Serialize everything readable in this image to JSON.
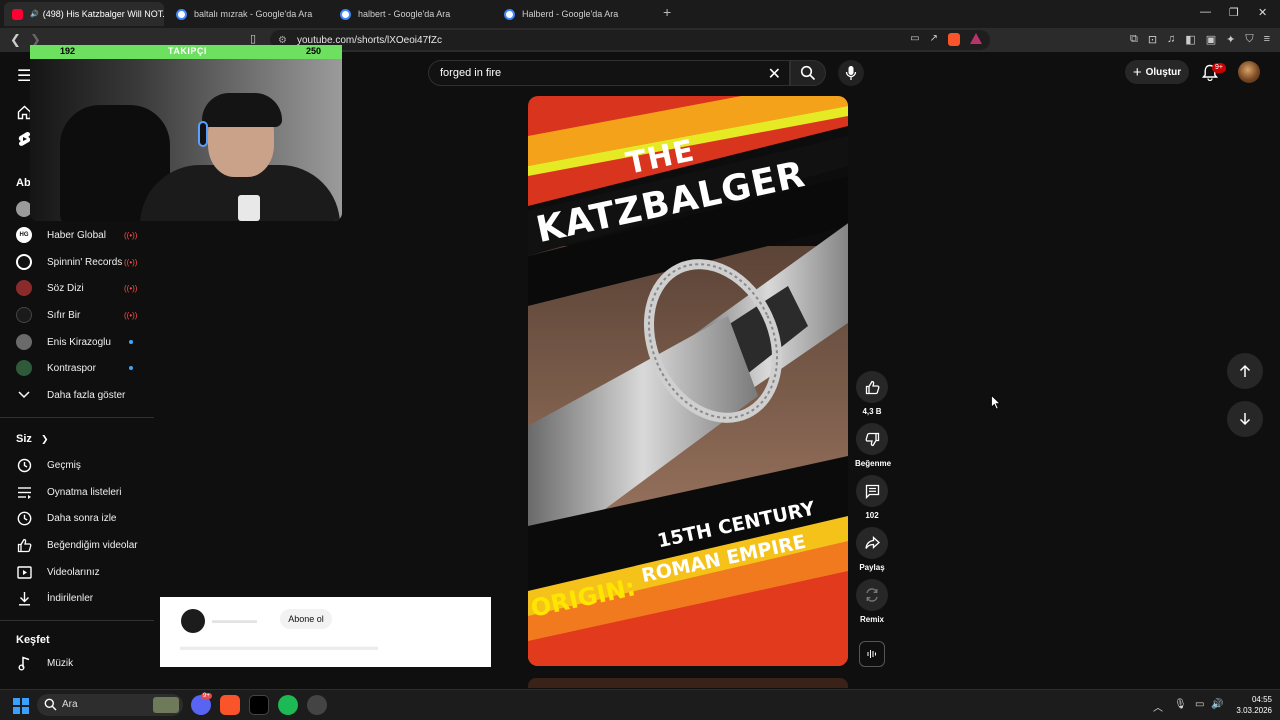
{
  "browser": {
    "tabs": [
      {
        "title": "(498) His Katzbalger Will NOT...",
        "active": true
      },
      {
        "title": "baltalı mızrak - Google'da Ara"
      },
      {
        "title": "halbert - Google'da Ara"
      },
      {
        "title": "Halberd - Google'da Ara"
      }
    ],
    "new_tab": "+",
    "url": "youtube.com/shorts/lXOeoi47fZc"
  },
  "header": {
    "search_query": "forged in fire",
    "create_label": "Oluştur",
    "notification_badge": "9+"
  },
  "webcam": {
    "left_count": "192",
    "label": "TAKIPÇI",
    "right_count": "250",
    "bar_color": "#6de060"
  },
  "sidebar": {
    "subscriptions_header": "Abo",
    "channels": [
      {
        "name": "Haber Global",
        "status": "live",
        "avatar": "HG"
      },
      {
        "name": "Spinnin' Records",
        "status": "live"
      },
      {
        "name": "Söz Dizi",
        "status": "live"
      },
      {
        "name": "Sıfır Bir",
        "status": "live"
      },
      {
        "name": "Enis Kirazoglu",
        "status": "new"
      },
      {
        "name": "Kontraspor",
        "status": "new"
      }
    ],
    "show_more": "Daha fazla göster",
    "you_header": "Siz",
    "you_items": [
      "Geçmiş",
      "Oynatma listeleri",
      "Daha sonra izle",
      "Beğendiğim videolar",
      "Videolarınız",
      "İndirilenler"
    ],
    "explore_header": "Keşfet",
    "explore_items": [
      "Müzik"
    ]
  },
  "short": {
    "title_line1": "THE",
    "title_line2": "KATZBALGER",
    "origin_label": "ORIGIN:",
    "origin_line1": "15TH CENTURY",
    "origin_line2": "ROMAN EMPIRE"
  },
  "actions": {
    "like_count": "4,3 B",
    "dislike_label": "Beğenme",
    "comment_count": "102",
    "share_label": "Paylaş",
    "remix_label": "Remix"
  },
  "card": {
    "subscribe_label": "Abone ol"
  },
  "taskbar": {
    "search_label": "Ara",
    "discord_badge": "9+",
    "time": "04:55",
    "date": "3.03.2026"
  },
  "colors": {
    "youtube_red": "#ff0033",
    "live_red": "#ff4e45",
    "new_dot": "#3ea6ff"
  }
}
